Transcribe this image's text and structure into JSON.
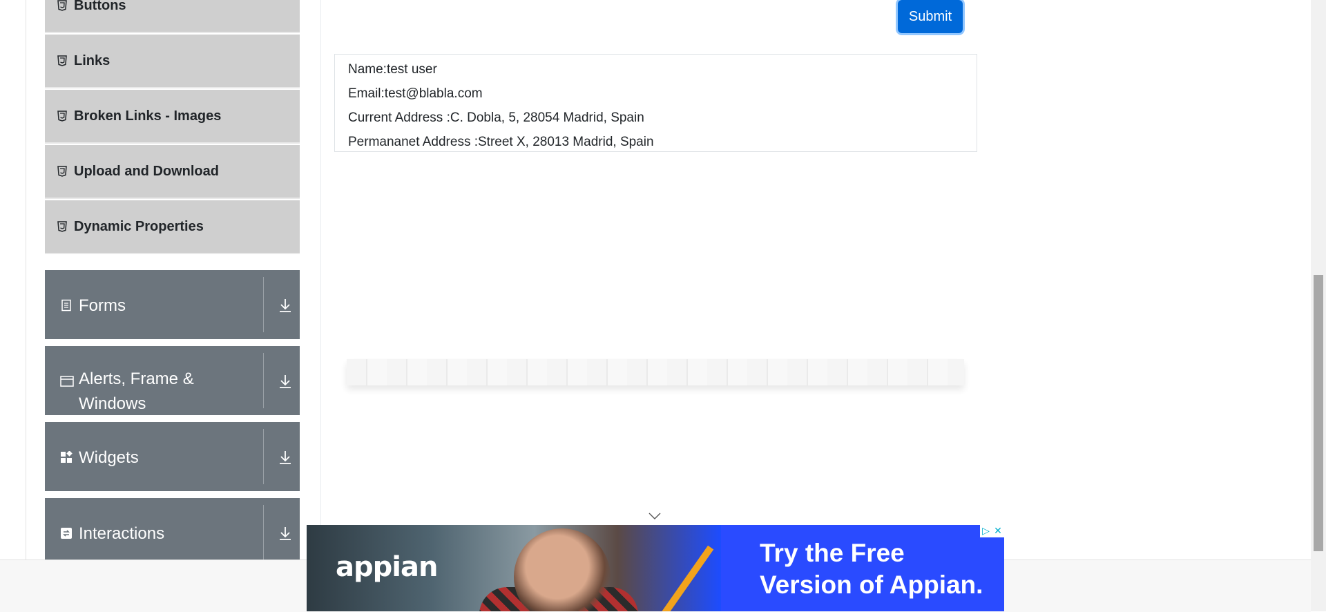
{
  "sidebar": {
    "items": [
      {
        "label": "Buttons",
        "icon": "html5-icon"
      },
      {
        "label": "Links",
        "icon": "html5-icon"
      },
      {
        "label": "Broken Links - Images",
        "icon": "html5-icon"
      },
      {
        "label": "Upload and Download",
        "icon": "html5-icon"
      },
      {
        "label": "Dynamic Properties",
        "icon": "html5-icon"
      }
    ],
    "groups": [
      {
        "label": "Forms",
        "icon": "form-icon"
      },
      {
        "label": "Alerts, Frame & Windows",
        "icon": "window-icon"
      },
      {
        "label": "Widgets",
        "icon": "widgets-icon"
      },
      {
        "label": "Interactions",
        "icon": "interactions-icon"
      }
    ]
  },
  "form": {
    "submit_label": "Submit"
  },
  "output": {
    "name": "Name:test user",
    "email": "Email:test@blabla.com",
    "current_address": "Current Address :C. Dobla, 5, 28054 Madrid, Spain",
    "permanent_address": "Permananet Address :Street X, 28013 Madrid, Spain"
  },
  "ad": {
    "logo": "appian",
    "headline_line1": "Try the Free",
    "headline_line2": "Version of Appian.",
    "adchoices_icon": "adchoices-icon",
    "close_icon": "close-icon"
  },
  "colors": {
    "sidebar_item_bg": "#cfcfcf",
    "group_header_bg": "#6c757d",
    "submit_bg": "#0069d9",
    "ad_bg": "#2a4bff"
  }
}
